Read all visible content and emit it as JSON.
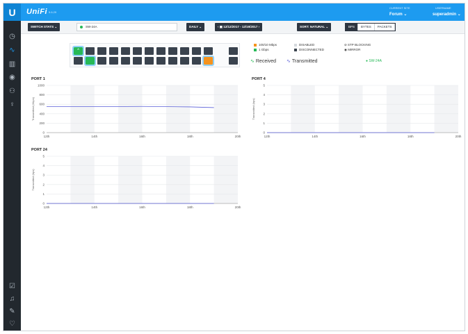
{
  "app": {
    "brand": "UniFi",
    "version": "5.6.29",
    "logo": "U"
  },
  "header": {
    "site_label": "CURRENT SITE",
    "site_value": "Forum",
    "user_label": "USERNAME",
    "user_value": "superadmin"
  },
  "sidebar": {
    "top": [
      "dashboard-icon",
      "statistics-icon",
      "map-icon",
      "devices-icon",
      "clients-icon",
      "insights-icon"
    ],
    "bottom": [
      "events-icon",
      "alerts-icon",
      "chat-icon",
      "heart-icon"
    ]
  },
  "toolbar": {
    "stats_button": "SWITCH STATS",
    "switch_select": "SW-24A",
    "interval": "DAILY",
    "date_range": "12/12/2017 - 12/19/2017",
    "sort": "SORT: NATURAL",
    "units": [
      "BPS",
      "BYTES",
      "PACKETS"
    ],
    "units_selected": "BPS"
  },
  "legend": {
    "speed_100": "100/10 Mbps",
    "speed_1g": "1 Gbps",
    "disabled": "DISABLED",
    "disconnected": "DISCONNECTED",
    "stp": "STP BLOCKING",
    "mirror": "MIRROR",
    "received": "Received",
    "transmitted": "Transmitted",
    "switch_name": "SW-24A",
    "colors": {
      "orange": "#f5931e",
      "green": "#27b957",
      "dark": "#3a434e",
      "received": "#27b957",
      "transmitted": "#5a5fd8"
    }
  },
  "charts": {
    "port1": {
      "title": "PORT 1"
    },
    "port4": {
      "title": "PORT 4"
    },
    "port24": {
      "title": "PORT 24"
    }
  },
  "chart_data": [
    {
      "type": "line",
      "title": "PORT 1",
      "ylabel": "Transmitted (Kbps)",
      "x": [
        "12th",
        "14th",
        "16th",
        "18th",
        "20th"
      ],
      "ylim": [
        0,
        1000
      ],
      "yticks": [
        0,
        200,
        400,
        600,
        800,
        1000
      ],
      "series": [
        {
          "name": "Transmitted",
          "points": [
            [
              0,
              550
            ],
            [
              1,
              550
            ],
            [
              2,
              555
            ],
            [
              3,
              545
            ],
            [
              3.5,
              530
            ]
          ]
        }
      ]
    },
    {
      "type": "line",
      "title": "PORT 4",
      "ylabel": "Transmitted (bps)",
      "x": [
        "12th",
        "14th",
        "16th",
        "18th",
        "20th"
      ],
      "ylim": [
        0,
        5
      ],
      "yticks": [
        0,
        1,
        2,
        3,
        4,
        5
      ],
      "series": [
        {
          "name": "Transmitted",
          "points": [
            [
              0,
              0
            ],
            [
              3.5,
              0
            ]
          ]
        }
      ]
    },
    {
      "type": "line",
      "title": "PORT 24",
      "ylabel": "Transmitted (bps)",
      "x": [
        "12th",
        "14th",
        "16th",
        "18th",
        "20th"
      ],
      "ylim": [
        0,
        5
      ],
      "yticks": [
        0,
        1,
        2,
        3,
        4,
        5
      ],
      "series": [
        {
          "name": "Transmitted",
          "points": [
            [
              0,
              0
            ],
            [
              3.5,
              0
            ]
          ]
        }
      ]
    }
  ]
}
